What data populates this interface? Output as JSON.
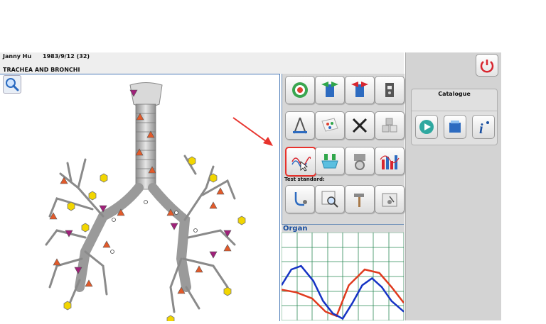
{
  "patient": {
    "name": "Janny Hu",
    "birth": "1983/9/12 (32)"
  },
  "organ_title": "TRACHEA AND BRONCHI",
  "tool_section_label": "Test standard:",
  "organ_section_label": "Organ",
  "catalogue": {
    "title": "Catalogue"
  },
  "colors": {
    "accent_blue": "#1a4fa0",
    "highlight_red": "#e8322c",
    "wave_red": "#e03a1e",
    "wave_blue": "#1633c4",
    "grid_green": "#2e8b57"
  },
  "tool_icons": [
    [
      "target-icon",
      "green-arrows-icon",
      "red-arrows-icon",
      "machine-icon"
    ],
    [
      "compass-icon",
      "pills-icon",
      "close-icon",
      "cubes-icon"
    ],
    [
      "wave-analyze-icon",
      "tray-icon",
      "gear-box-icon",
      "bar-wave-icon"
    ],
    [
      "stethoscope-icon",
      "magnify-chart-icon",
      "hammer-icon",
      "scale-icon"
    ]
  ],
  "catalogue_icons": [
    "play-icon",
    "cube-list-icon",
    "info-icon"
  ],
  "organ_wave_red": [
    [
      0,
      0.65
    ],
    [
      0.12,
      0.68
    ],
    [
      0.25,
      0.75
    ],
    [
      0.36,
      0.9
    ],
    [
      0.45,
      0.95
    ],
    [
      0.55,
      0.6
    ],
    [
      0.68,
      0.42
    ],
    [
      0.8,
      0.46
    ],
    [
      0.9,
      0.62
    ],
    [
      1.0,
      0.8
    ]
  ],
  "organ_wave_blue": [
    [
      0,
      0.6
    ],
    [
      0.08,
      0.42
    ],
    [
      0.16,
      0.38
    ],
    [
      0.26,
      0.55
    ],
    [
      0.34,
      0.78
    ],
    [
      0.42,
      0.92
    ],
    [
      0.5,
      0.98
    ],
    [
      0.58,
      0.8
    ],
    [
      0.66,
      0.6
    ],
    [
      0.74,
      0.52
    ],
    [
      0.82,
      0.62
    ],
    [
      0.9,
      0.78
    ],
    [
      1.0,
      0.9
    ]
  ]
}
